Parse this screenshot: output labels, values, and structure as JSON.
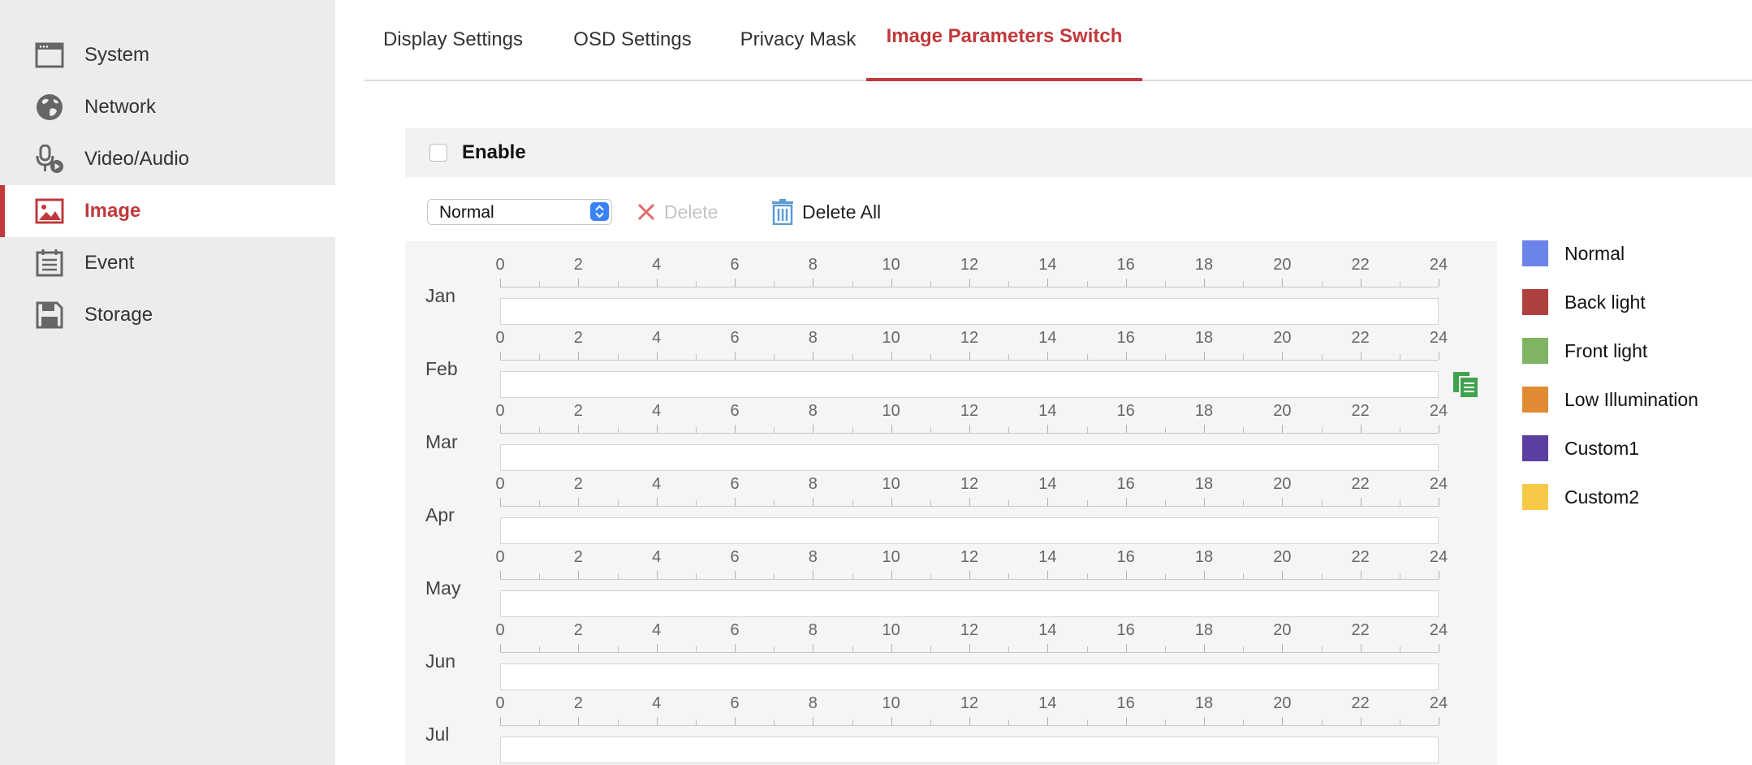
{
  "sidebar": {
    "items": [
      {
        "label": "System",
        "icon": "system-window-icon",
        "active": false
      },
      {
        "label": "Network",
        "icon": "globe-icon",
        "active": false
      },
      {
        "label": "Video/Audio",
        "icon": "microphone-icon",
        "active": false
      },
      {
        "label": "Image",
        "icon": "image-icon",
        "active": true
      },
      {
        "label": "Event",
        "icon": "calendar-icon",
        "active": false
      },
      {
        "label": "Storage",
        "icon": "floppy-disk-icon",
        "active": false
      }
    ]
  },
  "tabs": [
    {
      "label": "Display Settings",
      "active": false
    },
    {
      "label": "OSD Settings",
      "active": false
    },
    {
      "label": "Privacy Mask",
      "active": false
    },
    {
      "label": "Image Parameters Switch",
      "active": true
    }
  ],
  "enable": {
    "label": "Enable",
    "checked": false
  },
  "toolbar": {
    "mode_select": {
      "value": "Normal"
    },
    "delete_label": "Delete",
    "delete_all_label": "Delete All"
  },
  "schedule": {
    "hour_labels": [
      "0",
      "2",
      "4",
      "6",
      "8",
      "10",
      "12",
      "14",
      "16",
      "18",
      "20",
      "22",
      "24"
    ],
    "months": [
      "Jan",
      "Feb",
      "Mar",
      "Apr",
      "May",
      "Jun",
      "Jul"
    ]
  },
  "legend": [
    {
      "label": "Normal",
      "color": "#6b84ea"
    },
    {
      "label": "Back light",
      "color": "#b04040"
    },
    {
      "label": "Front light",
      "color": "#7fb562"
    },
    {
      "label": "Low Illumination",
      "color": "#e08a33"
    },
    {
      "label": "Custom1",
      "color": "#5b3ea0"
    },
    {
      "label": "Custom2",
      "color": "#f7c948"
    }
  ],
  "colors": {
    "accent": "#c0393b",
    "select_arrow": "#3a82f6",
    "copy_icon": "#3fa34d",
    "trash_icon": "#5b9bd5"
  }
}
